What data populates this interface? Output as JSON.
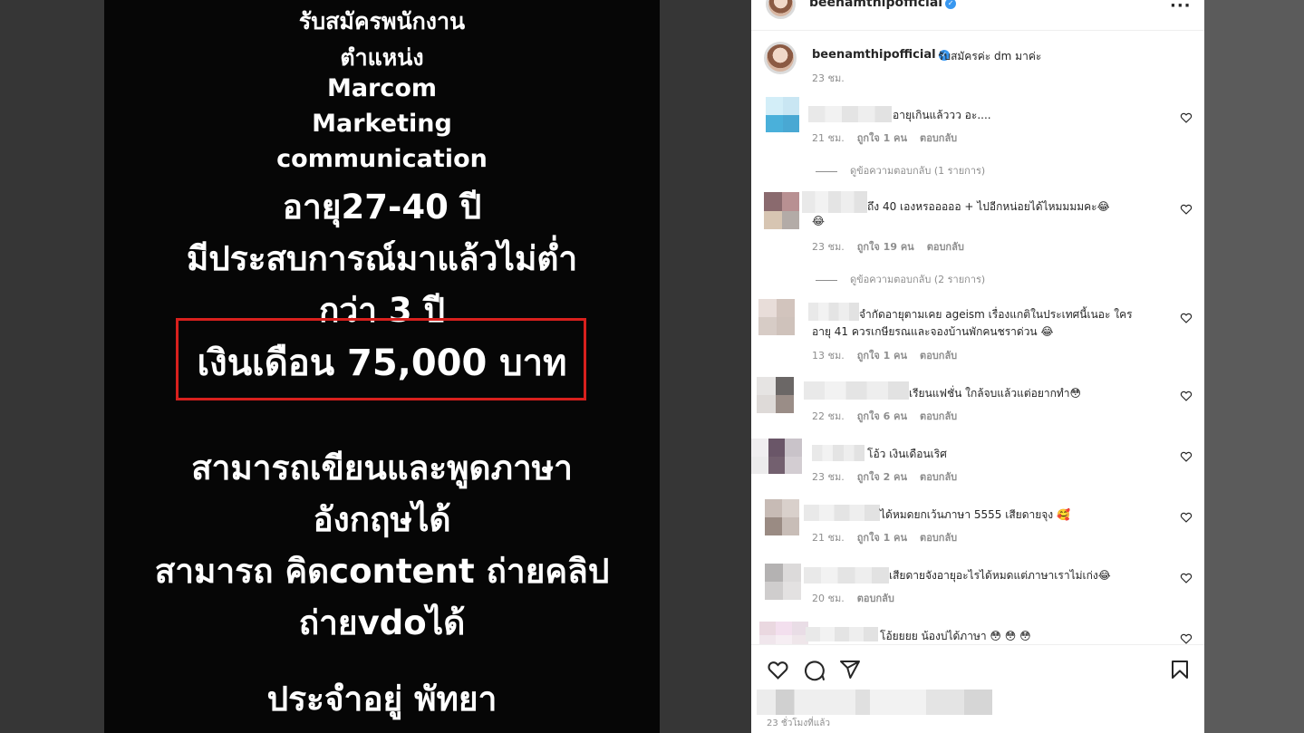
{
  "post_image": {
    "lines": [
      "รับสมัครพนักงาน",
      "ตำแหน่ง",
      "Marcom",
      "Marketing",
      "communication",
      "อายุ27-40 ปี",
      "มีประสบการณ์มาแล้วไม่ต่ำ",
      "กว่า 3 ปี",
      "เงินเดือน 75,000 บาท",
      "สามารถเขียนและพูดภาษา",
      "อังกฤษได้",
      "สามารถ คิดcontent ถ่ายคลิป",
      "ถ่ายvdoได้",
      "ประจำอยู่ พัทยา"
    ],
    "highlight_color": "#d8201d"
  },
  "header": {
    "username": "beenamthipofficial",
    "more_icon": "more-horizontal-icon"
  },
  "caption": {
    "username": "beenamthipofficial",
    "text": "รับสมัครค่ะ dm มาค่ะ",
    "time": "23 ชม."
  },
  "comments": [
    {
      "text": "อายุเกินแล้ววว อะ....",
      "time": "21 ชม.",
      "likes": "ถูกใจ 1 คน",
      "reply": "ตอบกลับ",
      "view_replies": "ดูข้อความตอบกลับ (1 รายการ)"
    },
    {
      "text": "ถึง 40 เองหรอออออ + ไปอีกหน่อยได้ไหมมมมคะ😂",
      "text2": "😂",
      "time": "23 ชม.",
      "likes": "ถูกใจ 19 คน",
      "reply": "ตอบกลับ",
      "view_replies": "ดูข้อความตอบกลับ (2 รายการ)"
    },
    {
      "text": "จำกัดอายุตามเคย ageism เรื่องแกติในประเทศนี้เนอะ ใคร",
      "text2": "อายุ 41 ควรเกษียรณและจองบ้านพักคนชราด่วน 😂",
      "time": "13 ชม.",
      "likes": "ถูกใจ 1 คน",
      "reply": "ตอบกลับ"
    },
    {
      "text": "เรียนแฟชั่น ใกล้จบแล้วแต่อยากทำ😳",
      "time": "22 ชม.",
      "likes": "ถูกใจ 6 คน",
      "reply": "ตอบกลับ"
    },
    {
      "text": "โอ้ว เงินเดือนเริศ",
      "time": "23 ชม.",
      "likes": "ถูกใจ 2 คน",
      "reply": "ตอบกลับ"
    },
    {
      "text": "ได้หมดยกเว้นภาษา 5555 เสียดายจุง 🥰",
      "time": "21 ชม.",
      "likes": "ถูกใจ 1 คน",
      "reply": "ตอบกลับ"
    },
    {
      "text": "เสียดายจังอายุอะไรได้หมดแต่ภาษาเราไม่เก่ง😂",
      "time": "20 ชม.",
      "reply": "ตอบกลับ"
    },
    {
      "text": "โอ้ยยยย น้องบ่ได้ภาษา 😳 😳 😳"
    }
  ],
  "actions": {
    "icons": [
      "heart-icon",
      "comment-icon",
      "share-icon",
      "bookmark-icon"
    ],
    "time_ago": "23 ชั่วโมงที่แล้ว"
  }
}
